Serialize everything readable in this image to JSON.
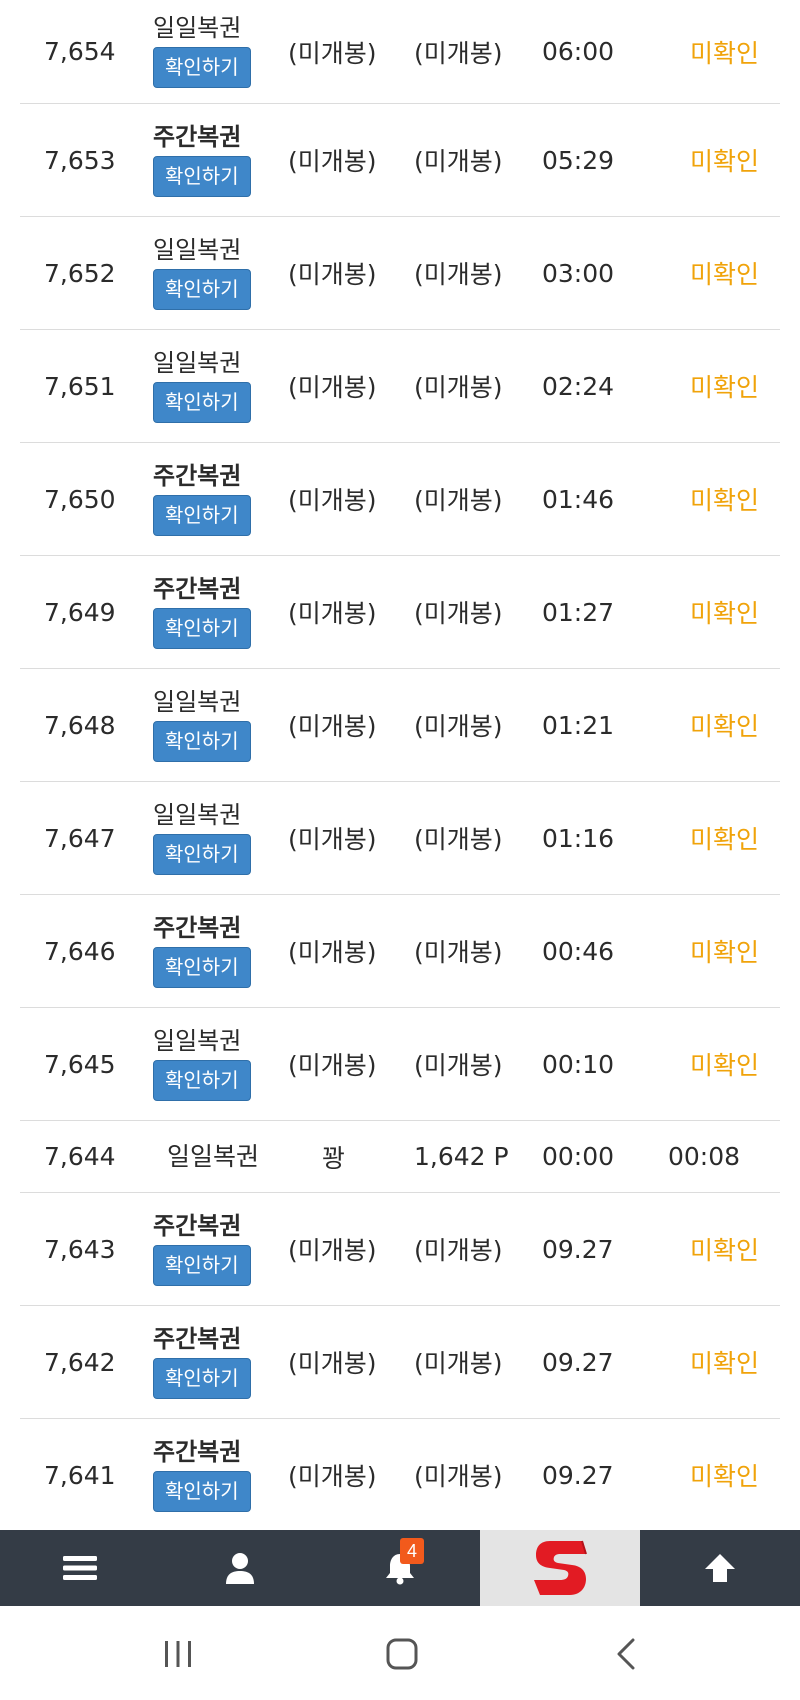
{
  "rows": [
    {
      "no": "7,654",
      "type": "일일복권",
      "bold": false,
      "button": "확인하기",
      "a": "(미개봉)",
      "b": "(미개봉)",
      "time": "06:00",
      "status": "미확인"
    },
    {
      "no": "7,653",
      "type": "주간복권",
      "bold": true,
      "button": "확인하기",
      "a": "(미개봉)",
      "b": "(미개봉)",
      "time": "05:29",
      "status": "미확인"
    },
    {
      "no": "7,652",
      "type": "일일복권",
      "bold": false,
      "button": "확인하기",
      "a": "(미개봉)",
      "b": "(미개봉)",
      "time": "03:00",
      "status": "미확인"
    },
    {
      "no": "7,651",
      "type": "일일복권",
      "bold": false,
      "button": "확인하기",
      "a": "(미개봉)",
      "b": "(미개봉)",
      "time": "02:24",
      "status": "미확인"
    },
    {
      "no": "7,650",
      "type": "주간복권",
      "bold": true,
      "button": "확인하기",
      "a": "(미개봉)",
      "b": "(미개봉)",
      "time": "01:46",
      "status": "미확인"
    },
    {
      "no": "7,649",
      "type": "주간복권",
      "bold": true,
      "button": "확인하기",
      "a": "(미개봉)",
      "b": "(미개봉)",
      "time": "01:27",
      "status": "미확인"
    },
    {
      "no": "7,648",
      "type": "일일복권",
      "bold": false,
      "button": "확인하기",
      "a": "(미개봉)",
      "b": "(미개봉)",
      "time": "01:21",
      "status": "미확인"
    },
    {
      "no": "7,647",
      "type": "일일복권",
      "bold": false,
      "button": "확인하기",
      "a": "(미개봉)",
      "b": "(미개봉)",
      "time": "01:16",
      "status": "미확인"
    },
    {
      "no": "7,646",
      "type": "주간복권",
      "bold": true,
      "button": "확인하기",
      "a": "(미개봉)",
      "b": "(미개봉)",
      "time": "00:46",
      "status": "미확인"
    },
    {
      "no": "7,645",
      "type": "일일복권",
      "bold": false,
      "button": "확인하기",
      "a": "(미개봉)",
      "b": "(미개봉)",
      "time": "00:10",
      "status": "미확인"
    },
    {
      "no": "7,644",
      "type": "일일복권",
      "bold": false,
      "button": "",
      "a": "꽝",
      "b": "1,642 P",
      "time": "00:00",
      "status": "00:08"
    },
    {
      "no": "7,643",
      "type": "주간복권",
      "bold": true,
      "button": "확인하기",
      "a": "(미개봉)",
      "b": "(미개봉)",
      "time": "09.27",
      "status": "미확인"
    },
    {
      "no": "7,642",
      "type": "주간복권",
      "bold": true,
      "button": "확인하기",
      "a": "(미개봉)",
      "b": "(미개봉)",
      "time": "09.27",
      "status": "미확인"
    },
    {
      "no": "7,641",
      "type": "주간복권",
      "bold": true,
      "button": "확인하기",
      "a": "(미개봉)",
      "b": "(미개봉)",
      "time": "09.27",
      "status": "미확인"
    }
  ],
  "bottom_nav": {
    "items": [
      {
        "name": "menu-icon"
      },
      {
        "name": "user-icon"
      },
      {
        "name": "bell-icon",
        "badge": "4"
      },
      {
        "name": "logo-icon"
      },
      {
        "name": "arrow-up-icon"
      }
    ]
  },
  "colors": {
    "accent_button": "#3f87c9",
    "unconfirmed": "#f0a30a",
    "nav_bg": "#343c46",
    "badge": "#f25a1c",
    "logo_red": "#e21b23"
  }
}
